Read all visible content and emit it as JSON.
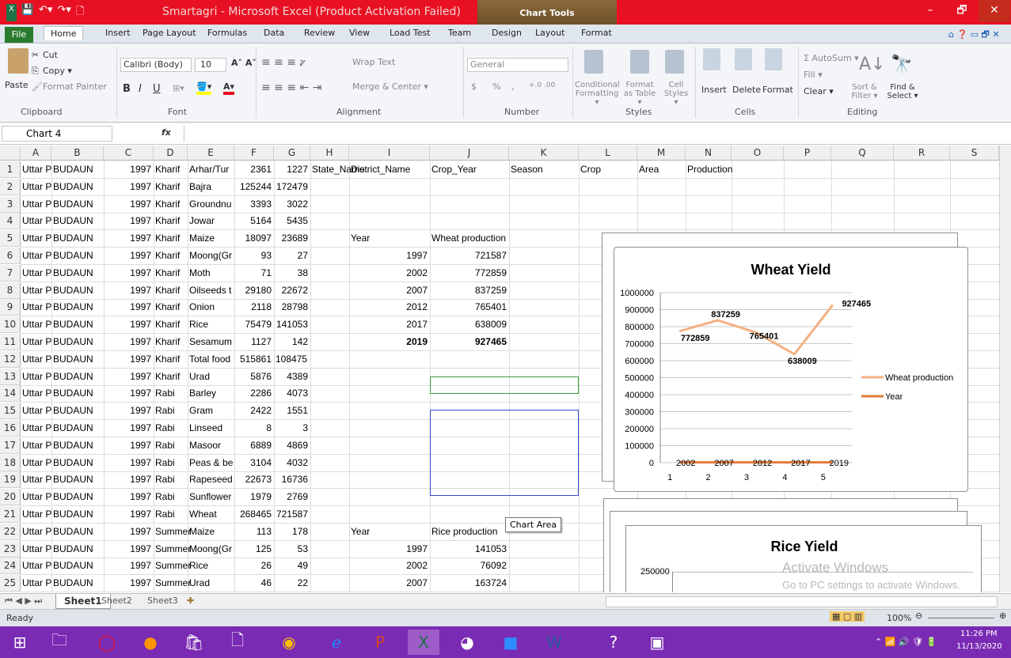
{
  "title_bar": {
    "title": "Smartagri - Microsoft Excel (Product Activation Failed)",
    "chart_tools": "Chart Tools",
    "minimize": "–",
    "restore": "🗗",
    "close": "✕"
  },
  "tabs": [
    "File",
    "Home",
    "Insert",
    "Page Layout",
    "Formulas",
    "Data",
    "Review",
    "View",
    "Load Test",
    "Team",
    "Design",
    "Layout",
    "Format"
  ],
  "ribbon": {
    "clipboard": {
      "paste": "Paste",
      "cut": "Cut",
      "copy": "Copy ▾",
      "format_painter": "Format Painter",
      "group": "Clipboard"
    },
    "font": {
      "name": "Calibri (Body)",
      "size": "10",
      "group": "Font",
      "bold": "B",
      "italic": "I",
      "underline": "U"
    },
    "alignment": {
      "wrap": "Wrap Text",
      "merge": "Merge & Center ▾",
      "group": "Alignment"
    },
    "number": {
      "format": "General",
      "group": "Number",
      "currency": "$",
      "percent": "%",
      "comma": ","
    },
    "styles": {
      "conditional": "Conditional Formatting ▾",
      "format_table": "Format as Table ▾",
      "cell_styles": "Cell Styles ▾",
      "group": "Styles"
    },
    "cells": {
      "insert": "Insert",
      "delete": "Delete",
      "format": "Format",
      "group": "Cells"
    },
    "editing": {
      "autosum": "Σ AutoSum ▾",
      "fill": "Fill ▾",
      "clear": "Clear ▾",
      "sort": "Sort & Filter ▾",
      "find": "Find & Select ▾",
      "group": "Editing"
    }
  },
  "formula_bar": {
    "name_box": "Chart 4",
    "fx": "fx",
    "formula": ""
  },
  "columns": [
    "A",
    "B",
    "C",
    "D",
    "E",
    "F",
    "G",
    "H",
    "I",
    "J",
    "K",
    "L",
    "M",
    "N",
    "O",
    "P",
    "Q",
    "R",
    "S"
  ],
  "rows": [
    [
      "Uttar Prad",
      "BUDAUN",
      "1997",
      "Kharif",
      "Arhar/Tur",
      "2361",
      "1227",
      "State_Name",
      "District_Name",
      "Crop_Year",
      "Season",
      "Crop",
      "Area",
      "Production"
    ],
    [
      "Uttar Prad",
      "BUDAUN",
      "1997",
      "Kharif",
      "Bajra",
      "125244",
      "172479"
    ],
    [
      "Uttar Prad",
      "BUDAUN",
      "1997",
      "Kharif",
      "Groundnu",
      "3393",
      "3022"
    ],
    [
      "Uttar Prad",
      "BUDAUN",
      "1997",
      "Kharif",
      "Jowar",
      "5164",
      "5435"
    ],
    [
      "Uttar Prad",
      "BUDAUN",
      "1997",
      "Kharif",
      "Maize",
      "18097",
      "23689",
      "",
      "Year",
      "Wheat production"
    ],
    [
      "Uttar Prad",
      "BUDAUN",
      "1997",
      "Kharif",
      "Moong(Gr",
      "93",
      "27",
      "",
      "1997",
      "721587"
    ],
    [
      "Uttar Prad",
      "BUDAUN",
      "1997",
      "Kharif",
      "Moth",
      "71",
      "38",
      "",
      "2002",
      "772859"
    ],
    [
      "Uttar Prad",
      "BUDAUN",
      "1997",
      "Kharif",
      "Oilseeds t",
      "29180",
      "22672",
      "",
      "2007",
      "837259"
    ],
    [
      "Uttar Prad",
      "BUDAUN",
      "1997",
      "Kharif",
      "Onion",
      "2118",
      "28798",
      "",
      "2012",
      "765401"
    ],
    [
      "Uttar Prad",
      "BUDAUN",
      "1997",
      "Kharif",
      "Rice",
      "75479",
      "141053",
      "",
      "2017",
      "638009"
    ],
    [
      "Uttar Prad",
      "BUDAUN",
      "1997",
      "Kharif",
      "Sesamum",
      "1127",
      "142",
      "",
      "2019",
      "927465"
    ],
    [
      "Uttar Prad",
      "BUDAUN",
      "1997",
      "Kharif",
      "Total food",
      "515861",
      "1084751"
    ],
    [
      "Uttar Prad",
      "BUDAUN",
      "1997",
      "Kharif",
      "Urad",
      "5876",
      "4389"
    ],
    [
      "Uttar Prad",
      "BUDAUN",
      "1997",
      "Rabi",
      "Barley",
      "2286",
      "4073"
    ],
    [
      "Uttar Prad",
      "BUDAUN",
      "1997",
      "Rabi",
      "Gram",
      "2422",
      "1551"
    ],
    [
      "Uttar Prad",
      "BUDAUN",
      "1997",
      "Rabi",
      "Linseed",
      "8",
      "3"
    ],
    [
      "Uttar Prad",
      "BUDAUN",
      "1997",
      "Rabi",
      "Masoor",
      "6889",
      "4869"
    ],
    [
      "Uttar Prad",
      "BUDAUN",
      "1997",
      "Rabi",
      "Peas & be",
      "3104",
      "4032"
    ],
    [
      "Uttar Prad",
      "BUDAUN",
      "1997",
      "Rabi",
      "Rapeseed",
      "22673",
      "16736"
    ],
    [
      "Uttar Prad",
      "BUDAUN",
      "1997",
      "Rabi",
      "Sunflower",
      "1979",
      "2769"
    ],
    [
      "Uttar Prad",
      "BUDAUN",
      "1997",
      "Rabi",
      "Wheat",
      "268465",
      "721587"
    ],
    [
      "Uttar Prad",
      "BUDAUN",
      "1997",
      "Summer",
      "Maize",
      "113",
      "178",
      "",
      "Year",
      "Rice production"
    ],
    [
      "Uttar Prad",
      "BUDAUN",
      "1997",
      "Summer",
      "Moong(Gr",
      "125",
      "53",
      "",
      "1997",
      "141053"
    ],
    [
      "Uttar Prad",
      "BUDAUN",
      "1997",
      "Summer",
      "Rice",
      "26",
      "49",
      "",
      "2002",
      "76092"
    ],
    [
      "Uttar Prad",
      "BUDAUN",
      "1997",
      "Summer",
      "Urad",
      "46",
      "22",
      "",
      "2007",
      "163724"
    ]
  ],
  "tooltip": "Chart Area",
  "chart_data": [
    {
      "type": "line",
      "title": "Wheat Yield",
      "categories": [
        "1",
        "2",
        "3",
        "4",
        "5"
      ],
      "series": [
        {
          "name": "Wheat production",
          "values": [
            772859,
            837259,
            765401,
            638009,
            927465
          ],
          "color": "#f4b183"
        },
        {
          "name": "Year",
          "values": [
            2002,
            2007,
            2012,
            2017,
            2019
          ],
          "color": "#e07b39"
        }
      ],
      "ylim": [
        0,
        1000000
      ],
      "yticks": [
        "1000000",
        "900000",
        "800000",
        "700000",
        "600000",
        "500000",
        "400000",
        "300000",
        "200000",
        "100000",
        "0"
      ],
      "data_labels": [
        "772859",
        "837259",
        "765401",
        "638009",
        "927465"
      ],
      "year_labels": [
        "2002",
        "2007",
        "2012",
        "2017",
        "2019"
      ],
      "legend": "right",
      "grid": true
    },
    {
      "type": "line",
      "title": "Rice Yield",
      "yticks": [
        "250000"
      ]
    }
  ],
  "watermark": {
    "line1": "Activate Windows",
    "line2": "Go to PC settings to activate Windows."
  },
  "sheets": [
    "Sheet1",
    "Sheet2",
    "Sheet3"
  ],
  "status": {
    "ready": "Ready",
    "zoom": "100%"
  },
  "clock": {
    "time": "11:26 PM",
    "date": "11/13/2020"
  }
}
